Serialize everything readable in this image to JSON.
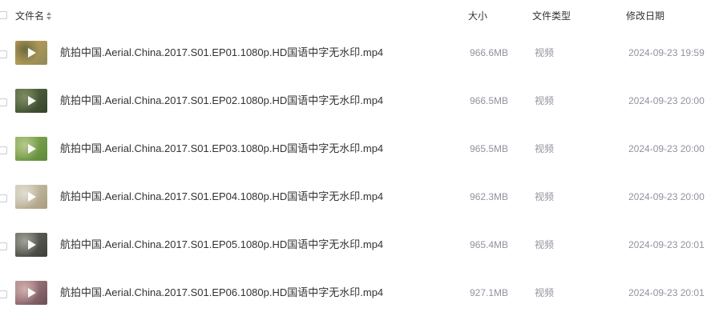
{
  "header": {
    "name_label": "文件名",
    "size_label": "大小",
    "type_label": "文件类型",
    "date_label": "修改日期"
  },
  "files": [
    {
      "name": "航拍中国.Aerial.China.2017.S01.EP01.1080p.HD国语中字无水印.mp4",
      "size": "966.6MB",
      "type": "视频",
      "date": "2024-09-23 19:59",
      "thumb_colors": [
        "#c9a35e",
        "#8f8a55",
        "#6a6b3e"
      ]
    },
    {
      "name": "航拍中国.Aerial.China.2017.S01.EP02.1080p.HD国语中字无水印.mp4",
      "size": "966.5MB",
      "type": "视频",
      "date": "2024-09-23 20:00",
      "thumb_colors": [
        "#5d7045",
        "#34432b",
        "#7f8c63"
      ]
    },
    {
      "name": "航拍中国.Aerial.China.2017.S01.EP03.1080p.HD国语中字无水印.mp4",
      "size": "965.5MB",
      "type": "视频",
      "date": "2024-09-23 20:00",
      "thumb_colors": [
        "#8fb05a",
        "#5d8a3a",
        "#b8c98f"
      ]
    },
    {
      "name": "航拍中国.Aerial.China.2017.S01.EP04.1080p.HD国语中字无水印.mp4",
      "size": "962.3MB",
      "type": "视频",
      "date": "2024-09-23 20:00",
      "thumb_colors": [
        "#d2cbb7",
        "#a89c7d",
        "#e0ddd2"
      ]
    },
    {
      "name": "航拍中国.Aerial.China.2017.S01.EP05.1080p.HD国语中字无水印.mp4",
      "size": "965.4MB",
      "type": "视频",
      "date": "2024-09-23 20:01",
      "thumb_colors": [
        "#6e6e66",
        "#3f3f3a",
        "#a0a296"
      ]
    },
    {
      "name": "航拍中国.Aerial.China.2017.S01.EP06.1080p.HD国语中字无水印.mp4",
      "size": "927.1MB",
      "type": "视频",
      "date": "2024-09-23 20:01",
      "thumb_colors": [
        "#b58a8d",
        "#6d4e57",
        "#d1b0ae"
      ]
    }
  ]
}
